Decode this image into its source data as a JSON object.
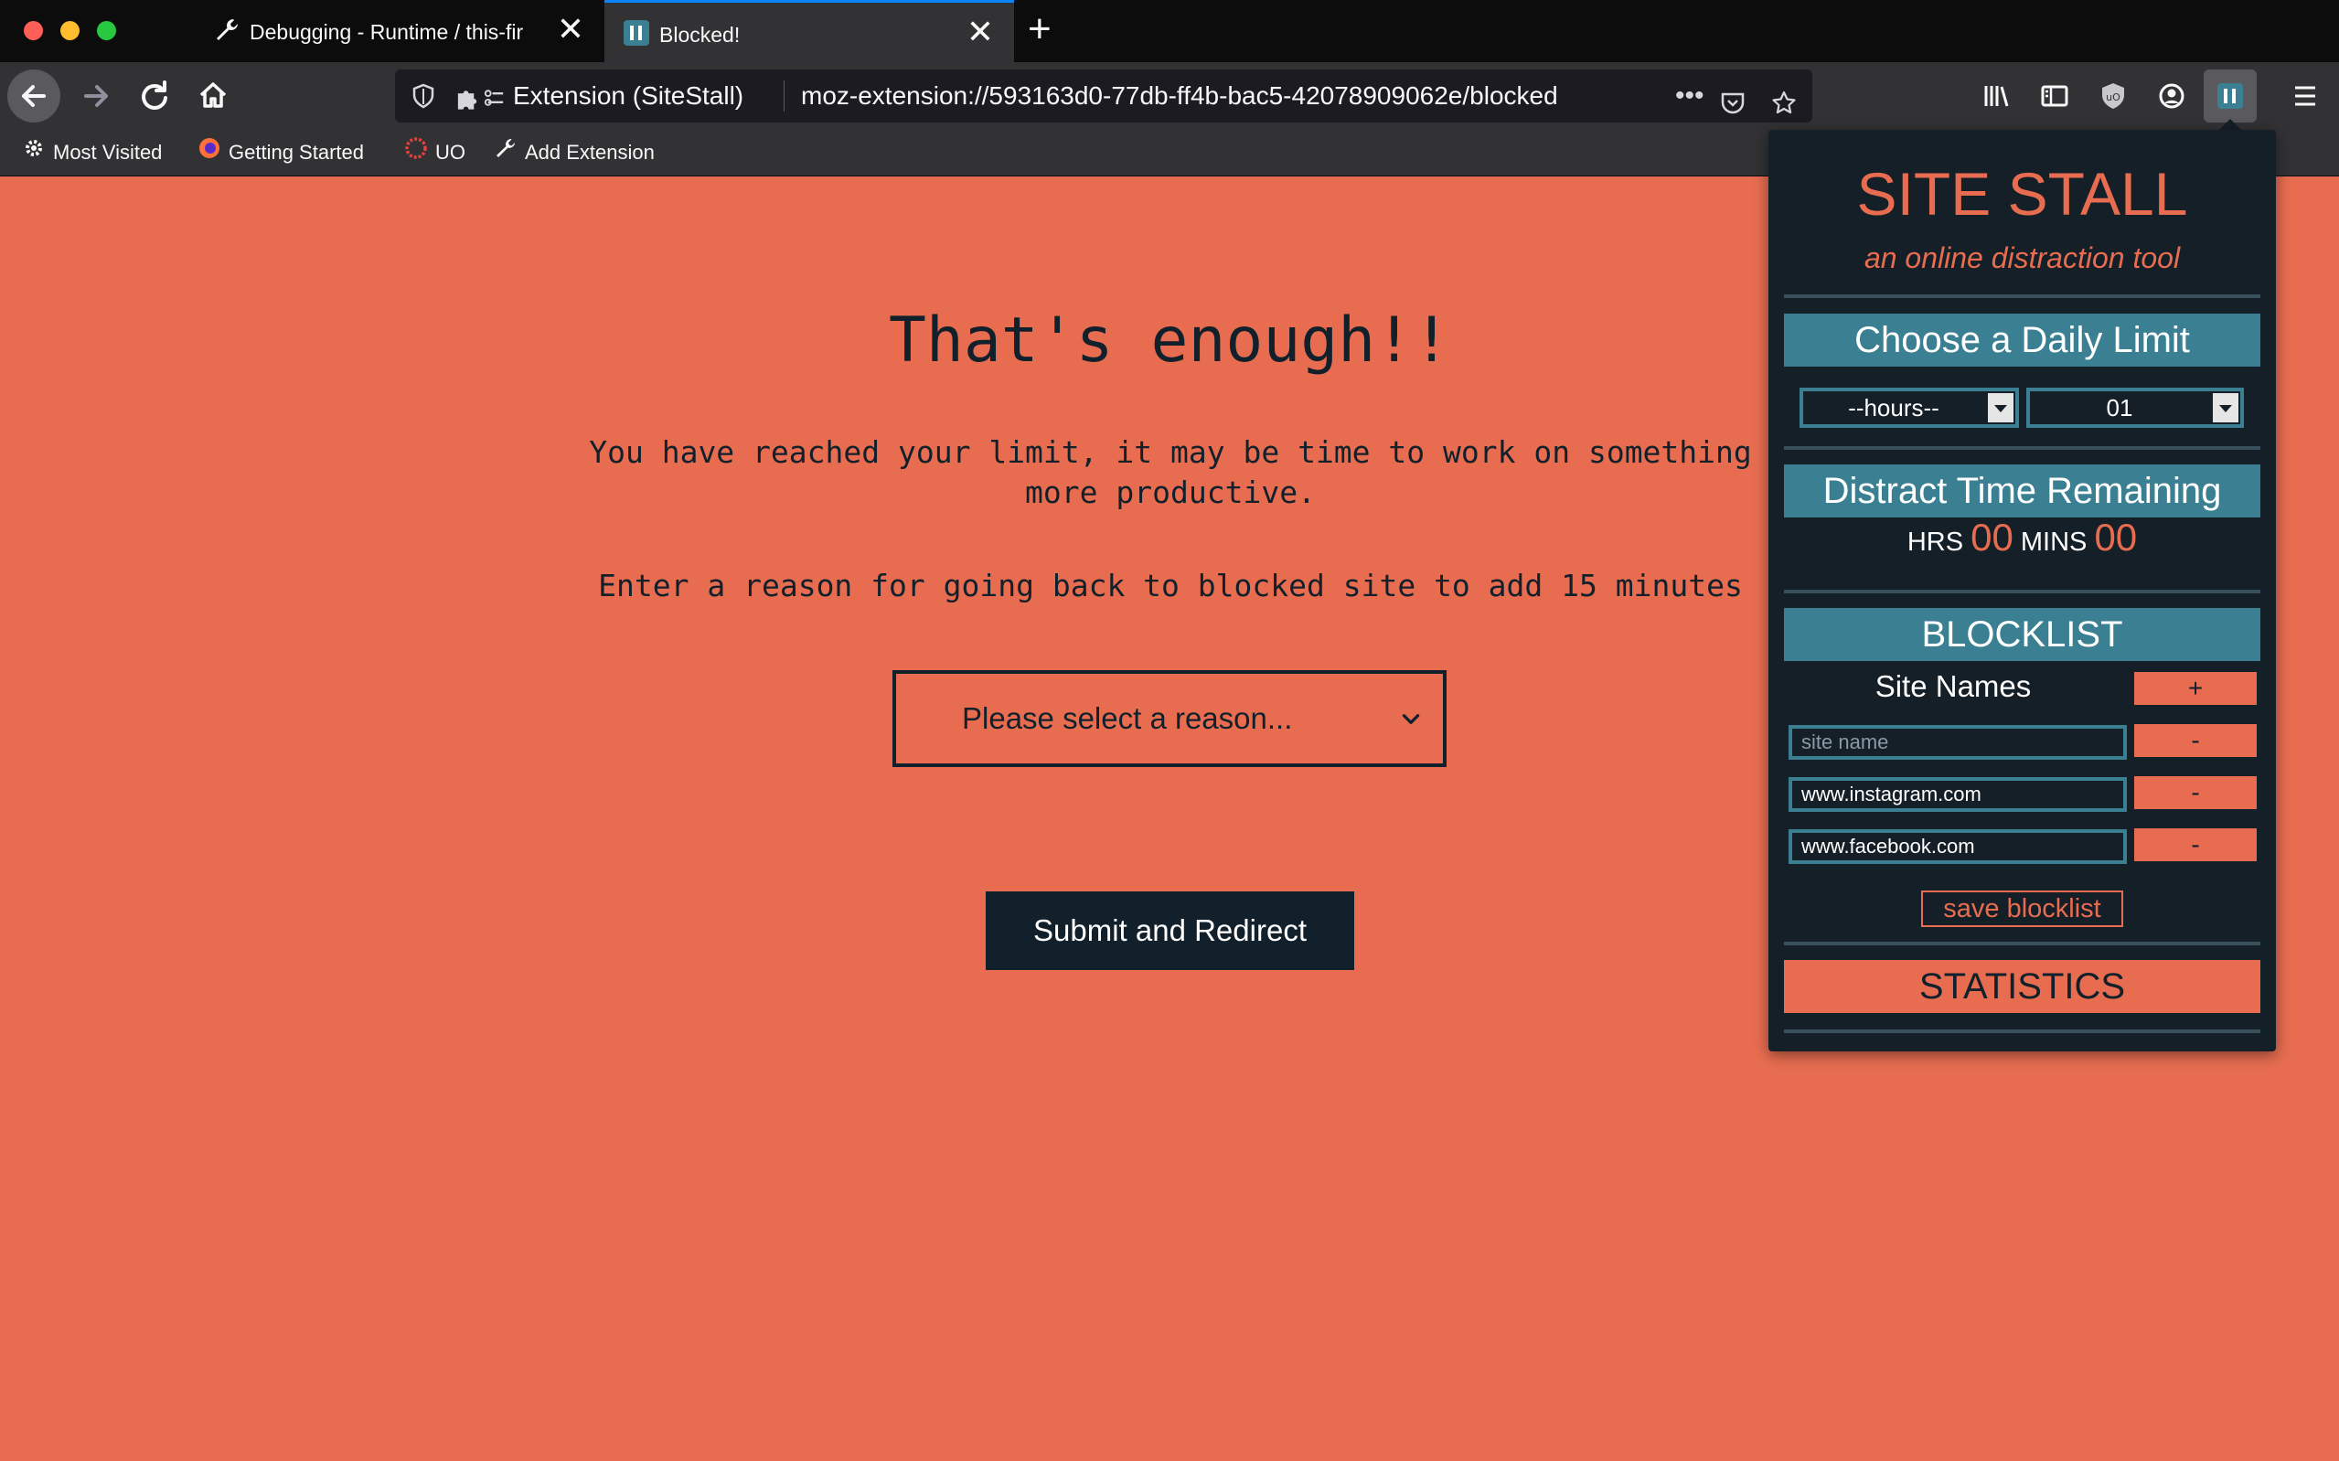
{
  "browser": {
    "tabs": [
      {
        "label": "Debugging - Runtime / this-firef",
        "active": false
      },
      {
        "label": "Blocked!",
        "active": true
      }
    ],
    "identity_label": "Extension (SiteStall)",
    "url": "moz-extension://593163d0-77db-ff4b-bac5-42078909062e/blocked",
    "bookmarks": [
      "Most Visited",
      "Getting Started",
      "UO",
      "Add Extension"
    ]
  },
  "page": {
    "heading": "That's enough!!",
    "message": "You have reached your limit, it may be time to work on something more productive.",
    "instruction": "Enter a reason for going back to blocked site to add 15 minutes",
    "reason_select": "Please select a reason...",
    "submit_label": "Submit and Redirect"
  },
  "popup": {
    "title": "SITE STALL",
    "subtitle": "an online distraction tool",
    "limit_heading": "Choose a Daily Limit",
    "hours_select": "--hours--",
    "minutes_select": "01",
    "remaining_heading": "Distract Time Remaining",
    "hrs_label": "HRS",
    "hrs_value": "00",
    "mins_label": "MINS",
    "mins_value": "00",
    "blocklist_heading": "BLOCKLIST",
    "site_names_label": "Site Names",
    "add_label": "+",
    "remove_label": "-",
    "site_placeholder": "site name",
    "sites": [
      "www.instagram.com",
      "www.facebook.com"
    ],
    "save_label": "save blocklist",
    "statistics_heading": "STATISTICS"
  },
  "colors": {
    "page_bg": "#e86d50",
    "dark": "#12202b",
    "popup_bg": "#151f27",
    "teal": "#3a7f92",
    "accent": "#e86d50"
  }
}
